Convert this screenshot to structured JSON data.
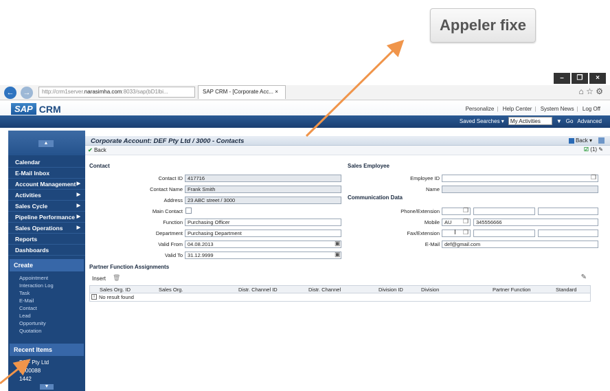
{
  "callout": {
    "label": "Appeler fixe"
  },
  "browser": {
    "address_gray": "http://crm1server.",
    "address_bold": "narasimha.com",
    "address_tail": ":8033/sap(bD1lbi...",
    "tab_title": "SAP CRM - [Corporate Acc...",
    "window_buttons": [
      "–",
      "❐",
      "×"
    ]
  },
  "sap": {
    "logo_sap": "SAP",
    "logo_crm": "CRM",
    "top_links": [
      "Personalize",
      "Help Center",
      "System News",
      "Log Off"
    ],
    "saved_searches": "Saved Searches ▾",
    "saved_select": "My Activities",
    "go": "Go",
    "advanced": "Advanced"
  },
  "sidebar": {
    "items": [
      {
        "label": "Calendar",
        "arrow": ""
      },
      {
        "label": "E-Mail Inbox",
        "arrow": ""
      },
      {
        "label": "Account Management",
        "arrow": "▶"
      },
      {
        "label": "Activities",
        "arrow": "▶"
      },
      {
        "label": "Sales Cycle",
        "arrow": "▶"
      },
      {
        "label": "Pipeline Performance",
        "arrow": "▶"
      },
      {
        "label": "Sales Operations",
        "arrow": "▶"
      },
      {
        "label": "Reports",
        "arrow": ""
      },
      {
        "label": "Dashboards",
        "arrow": ""
      }
    ],
    "create_header": "Create",
    "create_links": [
      "Appointment",
      "Interaction Log",
      "Task",
      "E-Mail",
      "Contact",
      "Lead",
      "Opportunity",
      "Quotation"
    ],
    "recent_header": "Recent Items",
    "recent_items": [
      "DEF Pty Ltd",
      "1000088",
      "1442"
    ]
  },
  "content": {
    "title": "Corporate Account: DEF Pty Ltd / 3000 - Contacts",
    "back_label": "Back",
    "back_button": "Back ▾",
    "contact_section": "Contact",
    "labels": {
      "contact_id": "Contact ID",
      "contact_name": "Contact Name",
      "address": "Address",
      "main_contact": "Main Contact",
      "function": "Function",
      "department": "Department",
      "valid_from": "Valid From",
      "valid_to": "Valid To",
      "employee_id": "Employee ID",
      "name": "Name",
      "phone": "Phone/Extension",
      "mobile": "Mobile",
      "fax": "Fax/Extension",
      "email": "E-Mail"
    },
    "values": {
      "contact_id": "417716",
      "contact_name": "Frank Smith",
      "address": "23 ABC street / 3000",
      "function": "Purchasing Officer",
      "department": "Purchasing Department",
      "valid_from": "04.08.2013",
      "valid_to": "31.12.9999",
      "mobile_country": "AU",
      "mobile": "345556666",
      "email": "def@gmail.com"
    },
    "sales_employee_section": "Sales Employee",
    "comm_section": "Communication Data",
    "partner_section": "Partner Function Assignments",
    "insert_label": "Insert",
    "table_headers": [
      "Sales Org. ID",
      "Sales Org.",
      "Distr. Channel ID",
      "Distr. Channel",
      "Division ID",
      "Division",
      "Partner Function",
      "Standard"
    ],
    "no_result": "No result found",
    "indicator": "(1)"
  },
  "colors": {
    "arrow": "#f0954b",
    "sidebar": "#1e477c"
  }
}
